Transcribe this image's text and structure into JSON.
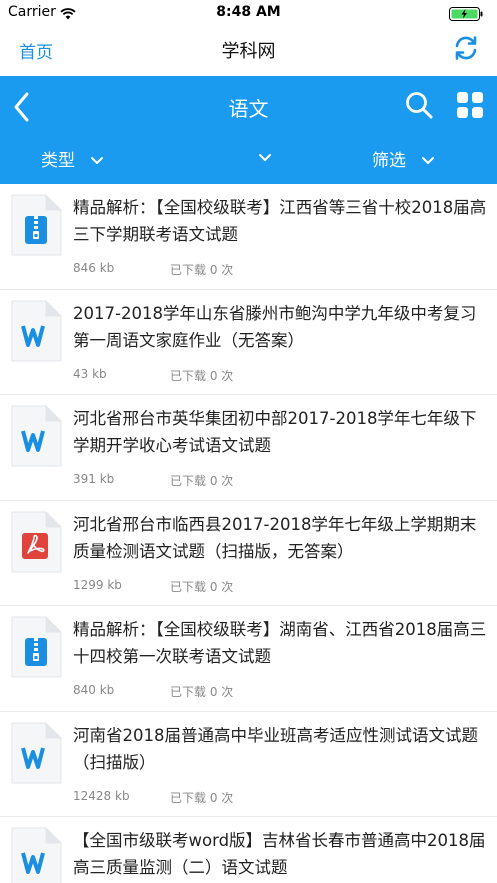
{
  "status_bar": {
    "carrier": "Carrier",
    "time": "8:48 AM"
  },
  "nav": {
    "home_label": "首页",
    "title": "学科网"
  },
  "header": {
    "subject": "语文",
    "filters": [
      {
        "label": "类型"
      },
      {
        "label": ""
      },
      {
        "label": "筛选"
      }
    ]
  },
  "colors": {
    "accent": "#1b9bf0",
    "link": "#1a8ee0",
    "word_icon": "#1a8ee0",
    "pdf_icon": "#e0433b",
    "zip_icon": "#1a8ee0"
  },
  "items": [
    {
      "icon": "zip-file-icon",
      "title": "精品解析：【全国校级联考】江西省等三省十校2018届高三下学期联考语文试题",
      "size": "846 kb",
      "downloads": "已下载 0 次"
    },
    {
      "icon": "word-file-icon",
      "title": "2017-2018学年山东省滕州市鲍沟中学九年级中考复习第一周语文家庭作业（无答案）",
      "size": "43 kb",
      "downloads": "已下载 0 次"
    },
    {
      "icon": "word-file-icon",
      "title": "河北省邢台市英华集团初中部2017-2018学年七年级下学期开学收心考试语文试题",
      "size": "391 kb",
      "downloads": "已下载 0 次"
    },
    {
      "icon": "pdf-file-icon",
      "title": "河北省邢台市临西县2017-2018学年七年级上学期期末质量检测语文试题（扫描版，无答案）",
      "size": "1299 kb",
      "downloads": "已下载 0 次"
    },
    {
      "icon": "zip-file-icon",
      "title": "精品解析：【全国校级联考】湖南省、江西省2018届高三十四校第一次联考语文试题",
      "size": "840 kb",
      "downloads": "已下载 0 次"
    },
    {
      "icon": "word-file-icon",
      "title": "河南省2018届普通高中毕业班高考适应性测试语文试题（扫描版）",
      "size": "12428 kb",
      "downloads": "已下载 0 次"
    },
    {
      "icon": "word-file-icon",
      "title": "【全国市级联考word版】吉林省长春市普通高中2018届高三质量监测（二）语文试题",
      "size": "",
      "downloads": ""
    }
  ]
}
